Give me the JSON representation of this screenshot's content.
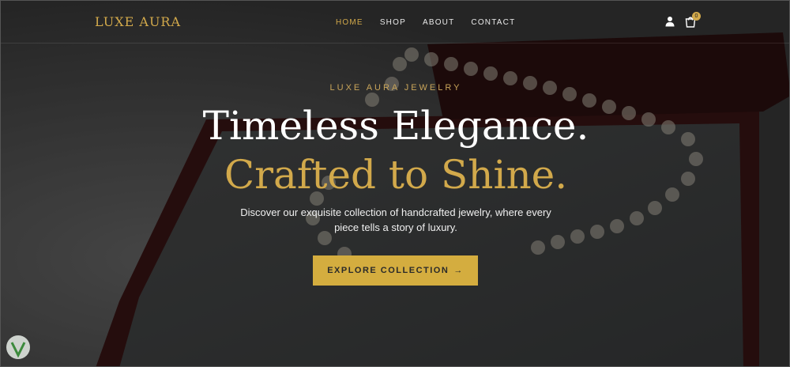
{
  "brand": {
    "logo_text": "LUXE AURA",
    "accent_color": "#d2a94b"
  },
  "nav": {
    "items": [
      {
        "label": "HOME",
        "active": true
      },
      {
        "label": "SHOP",
        "active": false
      },
      {
        "label": "ABOUT",
        "active": false
      },
      {
        "label": "CONTACT",
        "active": false
      }
    ]
  },
  "header_icons": {
    "user": "user-icon",
    "cart": "shopping-bag-icon",
    "cart_count": "0"
  },
  "hero": {
    "eyebrow": "LUXE AURA JEWELRY",
    "headline_line1": "Timeless Elegance.",
    "headline_line2": "Crafted to Shine.",
    "description": "Discover our exquisite collection of handcrafted jewelry, where every piece tells a story of luxury.",
    "cta_label": "EXPLORE COLLECTION",
    "cta_arrow": "→",
    "background": "pearl-necklace-in-jewelry-box-image"
  }
}
